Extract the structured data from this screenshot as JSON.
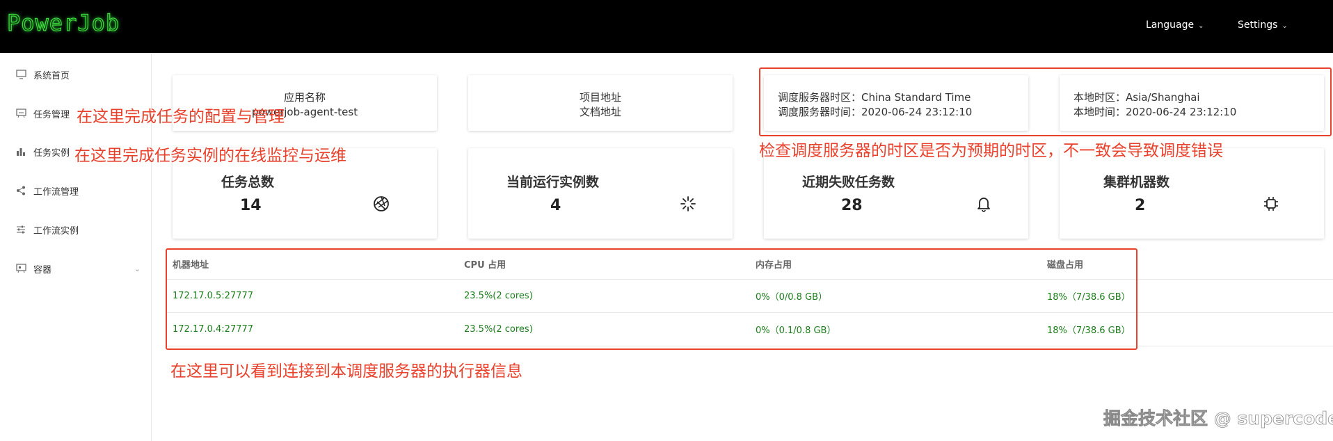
{
  "header": {
    "logo_text": "PowerJob",
    "language_label": "Language",
    "settings_label": "Settings"
  },
  "sidebar": {
    "items": [
      {
        "label": "系统首页",
        "icon": "monitor-icon"
      },
      {
        "label": "任务管理",
        "icon": "task-board-icon"
      },
      {
        "label": "任务实例",
        "icon": "bar-chart-icon"
      },
      {
        "label": "工作流管理",
        "icon": "share-icon"
      },
      {
        "label": "工作流实例",
        "icon": "sliders-icon"
      },
      {
        "label": "容器",
        "icon": "container-icon"
      }
    ]
  },
  "info": {
    "app_label": "应用名称",
    "app_name": "powerjob-agent-test",
    "project_address": "项目地址",
    "doc_address": "文档地址",
    "server_timezone": "调度服务器时区：China Standard Time",
    "server_time": "调度服务器时间：2020-06-24 23:12:10",
    "local_timezone": "本地时区：Asia/Shanghai",
    "local_time": "本地时间：2020-06-24 23:12:10"
  },
  "stats": [
    {
      "title": "任务总数",
      "value": "14",
      "icon": "aperture-icon"
    },
    {
      "title": "当前运行实例数",
      "value": "4",
      "icon": "loading-icon"
    },
    {
      "title": "近期失败任务数",
      "value": "28",
      "icon": "bell-icon"
    },
    {
      "title": "集群机器数",
      "value": "2",
      "icon": "cpu-icon"
    }
  ],
  "machines": {
    "headers": [
      "机器地址",
      "CPU 占用",
      "内存占用",
      "磁盘占用"
    ],
    "rows": [
      [
        "172.17.0.5:27777",
        "23.5%(2 cores)",
        "0%（0/0.8 GB）",
        "18%（7/38.6 GB）"
      ],
      [
        "172.17.0.4:27777",
        "23.5%(2 cores)",
        "0%（0.1/0.8 GB）",
        "18%（7/38.6 GB）"
      ]
    ]
  },
  "annotations": {
    "task_manage": "在这里完成任务的配置与管理",
    "task_instance": "在这里完成任务实例的在线监控与运维",
    "timezone_check": "检查调度服务器的时区是否为预期的时区，不一致会导致调度错误",
    "executors": "在这里可以看到连接到本调度服务器的执行器信息"
  },
  "watermark": "掘金技术社区 @ supercode",
  "colors": {
    "annotation_red": "#e8412c",
    "table_green": "#1a7d1a",
    "logo_green": "#3ee03e"
  }
}
